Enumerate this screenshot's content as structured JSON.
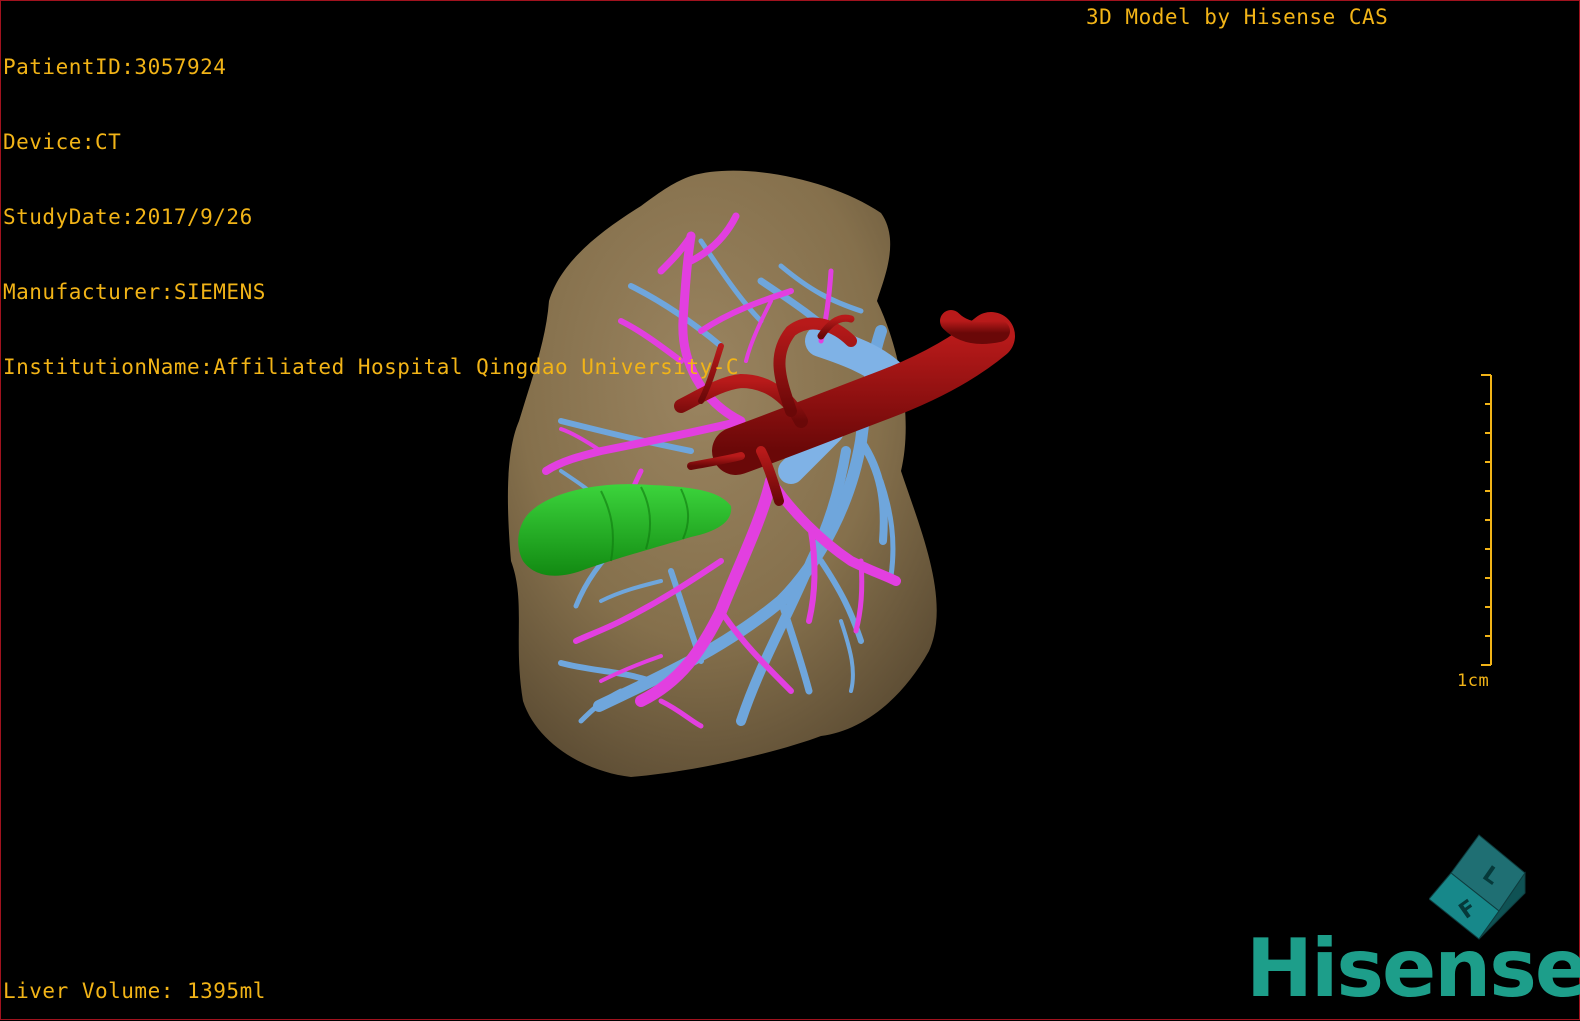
{
  "patient_info": {
    "patient_id": "PatientID:3057924",
    "device": "Device:CT",
    "study_date": "StudyDate:2017/9/26",
    "manufacturer": "Manufacturer:SIEMENS",
    "institution": "InstitutionName:Affiliated Hospital Qingdao University-C"
  },
  "model_credit": "3D Model by Hisense CAS",
  "liver_volume": "Liver Volume: 1395ml",
  "scale": {
    "label": "1cm"
  },
  "orientation_cube": {
    "face_letters": [
      "F",
      "L"
    ]
  },
  "brand": {
    "logo_text": "Hisense"
  },
  "colors": {
    "overlay_text": "#f2b417",
    "liver": "#8c7550",
    "portal_vein": "#e23fe0",
    "hepatic_vein": "#6fa6dc",
    "artery": "#9a1010",
    "tumor": "#18a818",
    "brand": "#1d9e8a"
  }
}
